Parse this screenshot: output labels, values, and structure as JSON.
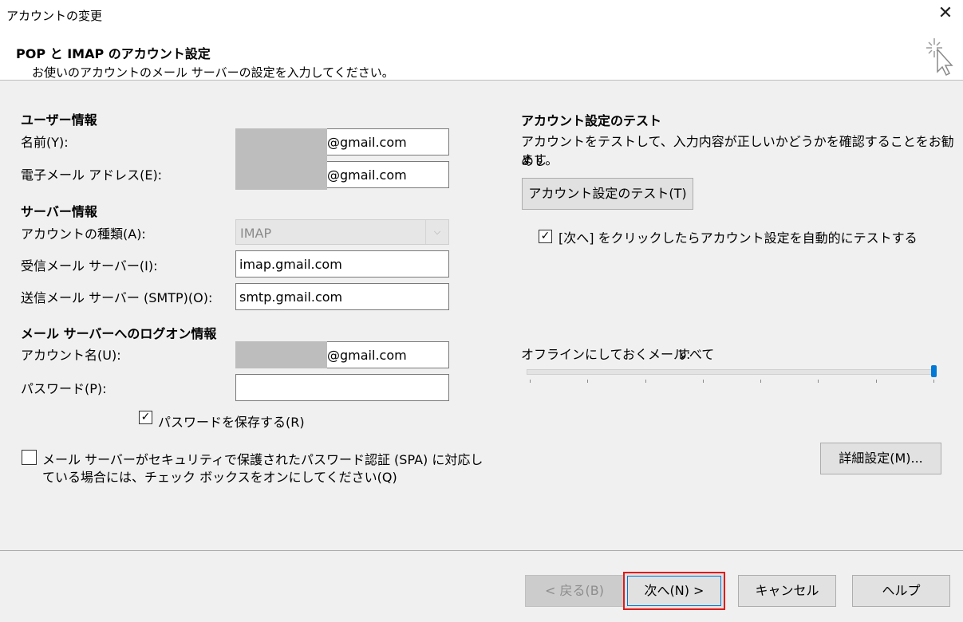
{
  "window": {
    "title": "アカウントの変更",
    "close_glyph": "✕"
  },
  "header": {
    "title": "POP と IMAP のアカウント設定",
    "subtitle": "お使いのアカウントのメール サーバーの設定を入力してください。"
  },
  "user_info": {
    "heading": "ユーザー情報",
    "name_label": "名前(Y):",
    "name_value": "@gmail.com",
    "email_label": "電子メール アドレス(E):",
    "email_value": "@gmail.com"
  },
  "server_info": {
    "heading": "サーバー情報",
    "account_type_label": "アカウントの種類(A):",
    "account_type_value": "IMAP",
    "incoming_label": "受信メール サーバー(I):",
    "incoming_value": "imap.gmail.com",
    "outgoing_label": "送信メール サーバー (SMTP)(O):",
    "outgoing_value": "smtp.gmail.com"
  },
  "logon_info": {
    "heading": "メール サーバーへのログオン情報",
    "account_name_label": "アカウント名(U):",
    "account_name_value": "@gmail.com",
    "password_label": "パスワード(P):",
    "password_value": "",
    "remember_password_label": "パスワードを保存する(R)",
    "remember_password_checked": true,
    "spa_label_line1": "メール サーバーがセキュリティで保護されたパスワード認証 (SPA) に対応し",
    "spa_label_line2": "ている場合には、チェック ボックスをオンにしてください(Q)",
    "spa_checked": false
  },
  "test_section": {
    "heading": "アカウント設定のテスト",
    "description_line1": "アカウントをテストして、入力内容が正しいかどうかを確認することをお勧めし",
    "description_line2": "ます。",
    "test_button_label": "アカウント設定のテスト(T)",
    "auto_test_label": "[次へ] をクリックしたらアカウント設定を自動的にテストする",
    "auto_test_checked": true
  },
  "offline": {
    "label": "オフラインにしておくメール:",
    "value": "すべて",
    "slider_level": 1.0
  },
  "more_settings_label": "詳細設定(M)...",
  "footer": {
    "back_label": "< 戻る(B)",
    "next_label": "次へ(N) >",
    "cancel_label": "キャンセル",
    "help_label": "ヘルプ"
  },
  "colors": {
    "accent": "#0078d7",
    "highlight_border": "#e01b1b",
    "redaction_mask": "#bdbdbd"
  },
  "icons": {
    "close": "close-icon",
    "wizard": "sparkle-cursor-icon",
    "checkmark": "checkmark-icon",
    "dropdown": "chevron-down-icon"
  }
}
